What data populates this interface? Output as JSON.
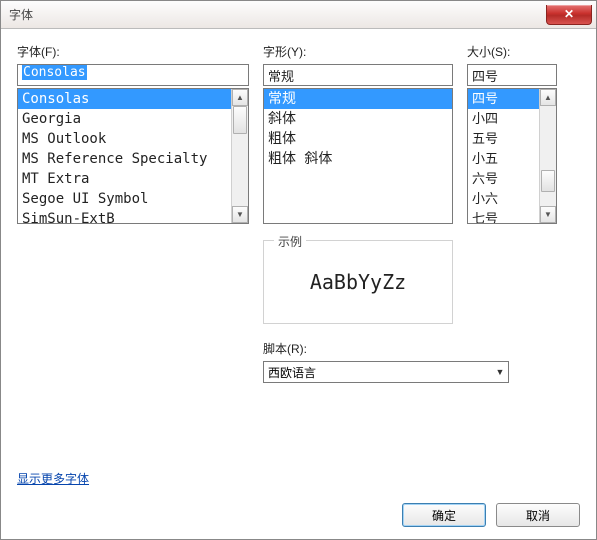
{
  "window": {
    "title": "字体"
  },
  "font": {
    "label": "字体(F):",
    "value": "Consolas",
    "items": [
      "Consolas",
      "Georgia",
      "MS Outlook",
      "MS Reference Specialty",
      "MT Extra",
      "Segoe UI Symbol",
      "SimSun-ExtB"
    ],
    "selected_index": 0
  },
  "style": {
    "label": "字形(Y):",
    "value": "常规",
    "items": [
      "常规",
      "斜体",
      "粗体",
      "粗体 斜体"
    ],
    "selected_index": 0
  },
  "size": {
    "label": "大小(S):",
    "value": "四号",
    "items": [
      "四号",
      "小四",
      "五号",
      "小五",
      "六号",
      "小六",
      "七号"
    ],
    "selected_index": 0
  },
  "sample": {
    "label": "示例",
    "text": "AaBbYyZz"
  },
  "script": {
    "label": "脚本(R):",
    "value": "西欧语言"
  },
  "more_link": "显示更多字体",
  "buttons": {
    "ok": "确定",
    "cancel": "取消"
  }
}
